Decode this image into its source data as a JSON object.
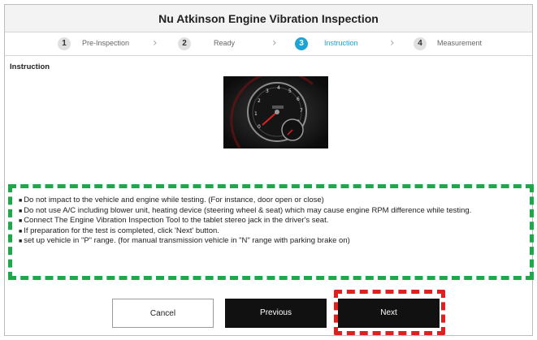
{
  "window": {
    "title": "Nu Atkinson Engine Vibration Inspection"
  },
  "steps": [
    {
      "num": "1",
      "label": "Pre-Inspection",
      "active": false
    },
    {
      "num": "2",
      "label": "Ready",
      "active": false
    },
    {
      "num": "3",
      "label": "Instruction",
      "active": true
    },
    {
      "num": "4",
      "label": "Measurement",
      "active": false
    }
  ],
  "section": {
    "label": "Instruction"
  },
  "instructions": [
    "Do not impact to the vehicle and engine while testing. (For instance, door open or close)",
    "Do not use A/C including blower unit, heating device (steering wheel & seat) which may cause engine RPM difference while testing.",
    "Connect The Engine Vibration Inspection Tool to the tablet stereo jack in the driver's seat.",
    "If preparation for the test is completed, click 'Next' button.",
    "set up vehicle in \"P\" range. (for manual transmission vehicle in \"N\" range with parking brake on)"
  ],
  "buttons": {
    "cancel": "Cancel",
    "previous": "Previous",
    "next": "Next"
  },
  "colors": {
    "active_step": "#1ca4d9",
    "instruction_highlight": "#1fa84a",
    "next_highlight": "#e01f1f"
  },
  "image": {
    "subject": "instrument-cluster-photo"
  }
}
